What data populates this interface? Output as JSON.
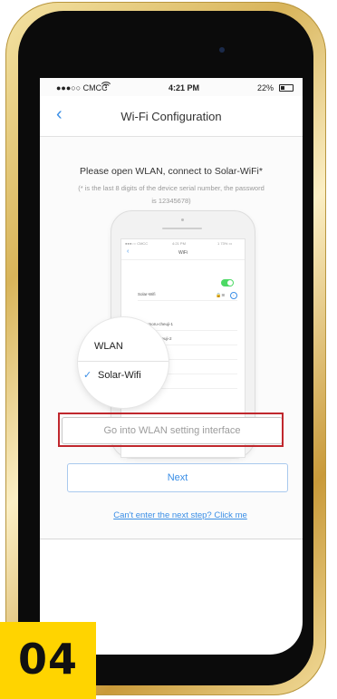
{
  "status_bar": {
    "carrier": "●●●○○ CMCC",
    "wifi_icon": "wifi-icon",
    "time": "4:21 PM",
    "battery": "22%"
  },
  "nav": {
    "back_icon": "chevron-left-icon",
    "title": "Wi-Fi Configuration"
  },
  "instruction": "Please open WLAN, connect to Solar-WiFi*",
  "note": "(* is the last 8 digits of the device serial number, the password is 12345678)",
  "illustration": {
    "status_left": "●●●○○ CMCC",
    "status_time": "4:21 PM",
    "status_right": "1 73% ▭",
    "nav_back": "‹",
    "nav_title": "WiFi",
    "rows": [
      "Solar-Wifi",
      "Bodiamoru-cheuji-1",
      "Bodimono-cheuji-2",
      "NRO2IB782",
      "QYKF1301",
      "BB4D65-CS"
    ],
    "magnifier": {
      "header": "WLAN",
      "check": "✓",
      "ssid": "Solar-Wifi"
    }
  },
  "buttons": {
    "wlan_setting": "Go into WLAN setting interface",
    "next": "Next"
  },
  "help_link": "Can't enter the next step? Click me",
  "step_badge": "04",
  "colors": {
    "frame_gold": "#d8b45a",
    "accent_blue": "#3a8ee6",
    "highlight_red": "#c0272d",
    "badge_yellow": "#ffd400"
  }
}
